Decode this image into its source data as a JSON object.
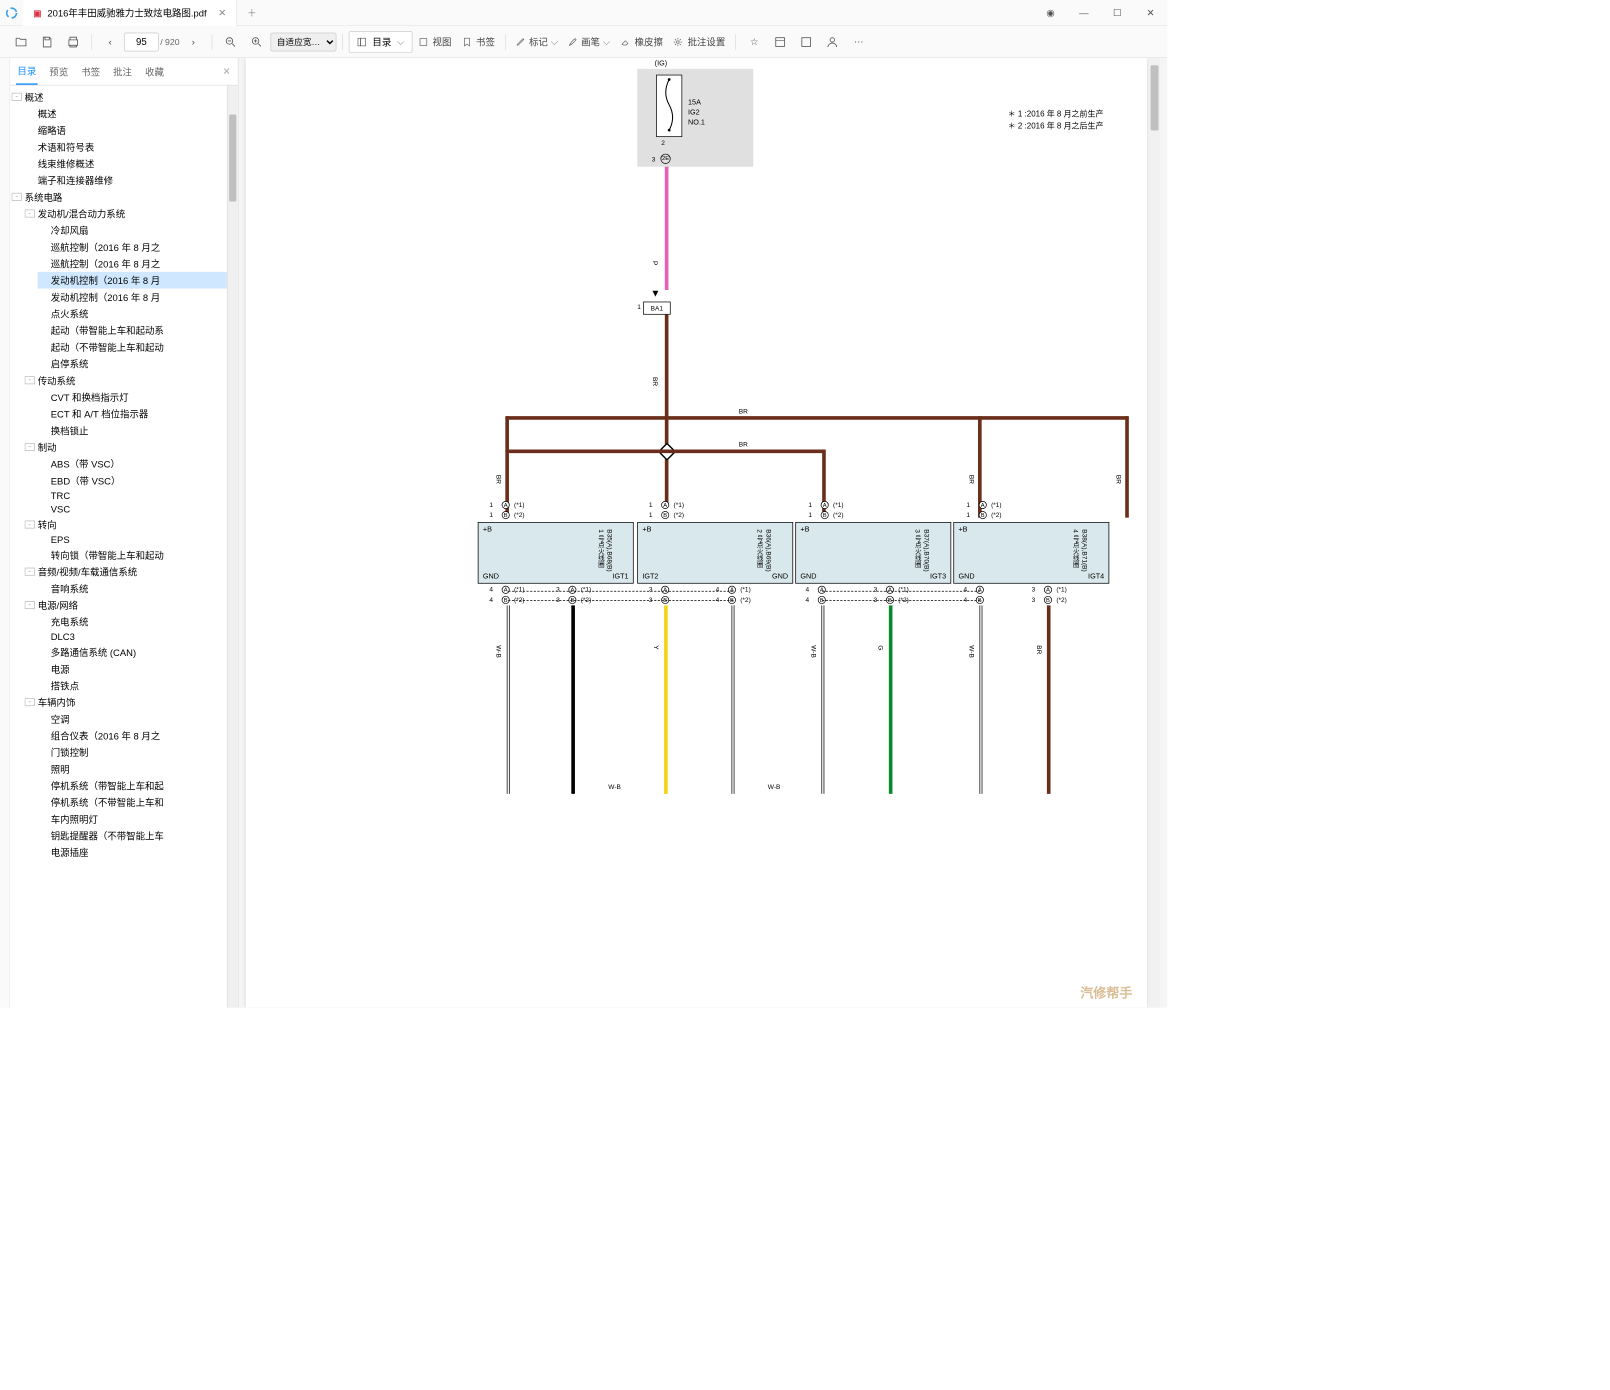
{
  "tab": {
    "title": "2016年丰田威驰雅力士致炫电路图.pdf"
  },
  "toolbar": {
    "page_current": "95",
    "page_total": "/ 920",
    "zoom": "自适应宽…",
    "outline": "目录",
    "view": "视图",
    "bookmark": "书签",
    "mark": "标记",
    "brush": "画笔",
    "eraser": "橡皮擦",
    "annot_settings": "批注设置"
  },
  "sidetabs": {
    "outline": "目录",
    "preview": "预览",
    "bookmark": "书签",
    "annot": "批注",
    "fav": "收藏"
  },
  "tree": {
    "n0": "概述",
    "n0_0": "概述",
    "n0_1": "缩略语",
    "n0_2": "术语和符号表",
    "n0_3": "线束维修概述",
    "n0_4": "端子和连接器维修",
    "n1": "系统电路",
    "n1_0": "发动机/混合动力系统",
    "n1_0_0": "冷却风扇",
    "n1_0_1": "巡航控制（2016 年 8 月之",
    "n1_0_2": "巡航控制（2016 年 8 月之",
    "n1_0_3": "发动机控制（2016 年 8 月",
    "n1_0_4": "发动机控制（2016 年 8 月",
    "n1_0_5": "点火系统",
    "n1_0_6": "起动（带智能上车和起动系",
    "n1_0_7": "起动（不带智能上车和起动",
    "n1_0_8": "启停系统",
    "n1_1": "传动系统",
    "n1_1_0": "CVT 和换档指示灯",
    "n1_1_1": "ECT 和 A/T 档位指示器",
    "n1_1_2": "换档锁止",
    "n1_2": "制动",
    "n1_2_0": "ABS（带 VSC）",
    "n1_2_1": "EBD（带 VSC）",
    "n1_2_2": "TRC",
    "n1_2_3": "VSC",
    "n1_3": "转向",
    "n1_3_0": "EPS",
    "n1_3_1": "转向锁（带智能上车和起动",
    "n1_4": "音频/视频/车载通信系统",
    "n1_4_0": "音响系统",
    "n1_5": "电源/网络",
    "n1_5_0": "充电系统",
    "n1_5_1": "DLC3",
    "n1_5_2": "多路通信系统 (CAN)",
    "n1_5_3": "电源",
    "n1_5_4": "搭铁点",
    "n1_6": "车辆内饰",
    "n1_6_0": "空调",
    "n1_6_1": "组合仪表（2016 年 8 月之",
    "n1_6_2": "门锁控制",
    "n1_6_3": "照明",
    "n1_6_4": "停机系统（带智能上车和起",
    "n1_6_5": "停机系统（不带智能上车和",
    "n1_6_6": "车内照明灯",
    "n1_6_7": "钥匙提醒器（不带智能上车",
    "n1_6_8": "电源插座"
  },
  "diagram": {
    "ig": "(IG)",
    "fuse": "15A\nIG2\nNO.1",
    "note1": "＊ 1 :2016 年 8 月之前生产",
    "note2": "＊ 2 :2016 年 8 月之后生产",
    "ba1": "BA1",
    "p": "P",
    "br": "BR",
    "wb": "W-B",
    "y": "Y",
    "g": "G",
    "bp": "+B",
    "gnd": "GND",
    "igt1": "IGT1",
    "igt2": "IGT2",
    "igt3": "IGT3",
    "igt4": "IGT4",
    "c1": "B35(A),B68(B)\n1 号点火线圈",
    "c2": "B36(A),B69(B)\n2 号点火线圈",
    "c3": "B37(A),B70(B)\n3 号点火线圈",
    "c4": "B38(A),B71(B)\n4 号点火线圈",
    "a1": "(*1)",
    "a2": "(*2)"
  },
  "watermark": "汽修帮手"
}
